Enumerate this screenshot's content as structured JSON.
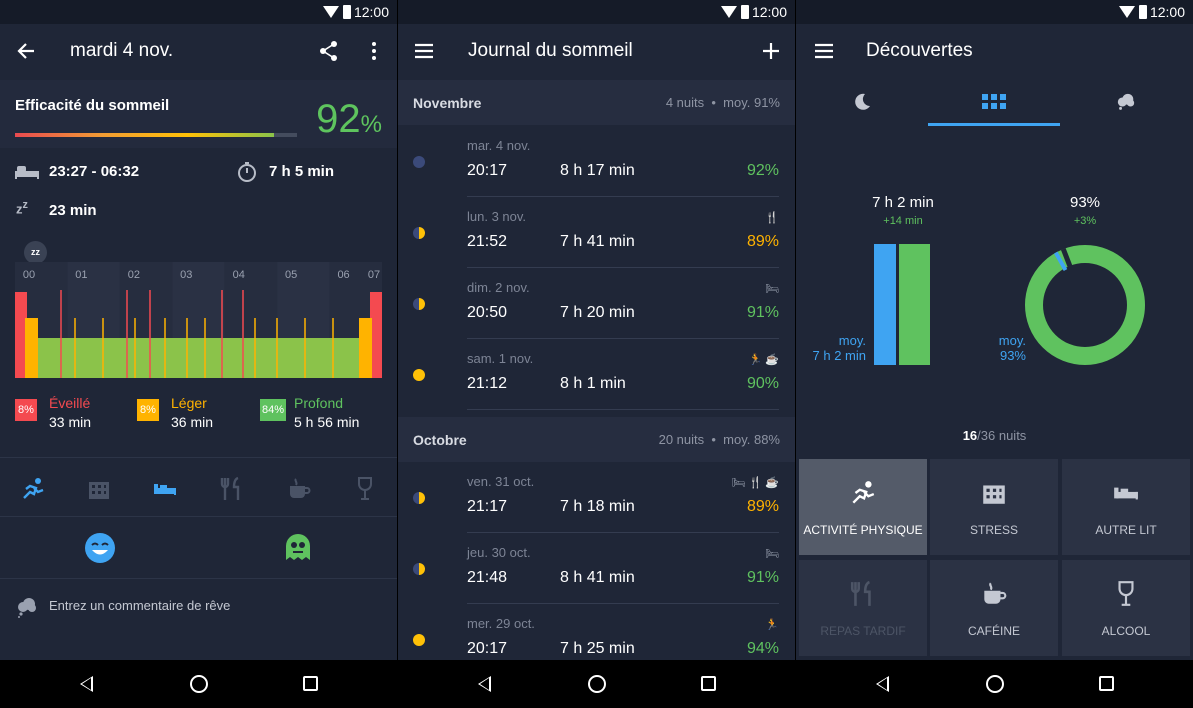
{
  "status_time": "12:00",
  "screen1": {
    "title": "mardi 4 nov.",
    "efficiency_label": "Efficacité du sommeil",
    "efficiency_value": "92",
    "efficiency_unit": "%",
    "efficiency_fraction": 0.92,
    "bed_time": "23:27 - 06:32",
    "duration": "7 h 5 min",
    "fall_asleep": "23 min",
    "hours": [
      "00",
      "01",
      "02",
      "03",
      "04",
      "05",
      "06",
      "07"
    ],
    "legend": [
      {
        "pct": "8%",
        "name": "Éveillé",
        "time": "33 min",
        "color": "#f44a50"
      },
      {
        "pct": "8%",
        "name": "Léger",
        "time": "36 min",
        "color": "#ffb300"
      },
      {
        "pct": "84%",
        "name": "Profond",
        "time": "5 h 56 min",
        "color": "#5fc25f"
      }
    ],
    "comment_placeholder": "Entrez un commentaire de rêve"
  },
  "screen2": {
    "title": "Journal du sommeil",
    "sections": [
      {
        "name": "Novembre",
        "meta": "4 nuits",
        "avg": "moy. 91%"
      },
      {
        "name": "Octobre",
        "meta": "20 nuits",
        "avg": "moy. 88%"
      }
    ],
    "entries": [
      {
        "day": "mar. 4 nov.",
        "bed": "20:17",
        "dur": "8 h 17 min",
        "q": "92%",
        "qcolor": "#5fc25f",
        "icons": "",
        "moon": "#3b4a7a"
      },
      {
        "day": "lun. 3 nov.",
        "bed": "21:52",
        "dur": "7 h 41 min",
        "q": "89%",
        "qcolor": "#ffb300",
        "icons": "🍴",
        "moon": "#ffc107"
      },
      {
        "day": "dim. 2 nov.",
        "bed": "20:50",
        "dur": "7 h 20 min",
        "q": "91%",
        "qcolor": "#5fc25f",
        "icons": "🛏",
        "moon": "#ffc107"
      },
      {
        "day": "sam. 1 nov.",
        "bed": "21:12",
        "dur": "8 h 1 min",
        "q": "90%",
        "qcolor": "#5fc25f",
        "icons": "🏃 ☕",
        "moon": "#ffc107"
      },
      {
        "day": "ven. 31 oct.",
        "bed": "21:17",
        "dur": "7 h 18 min",
        "q": "89%",
        "qcolor": "#ffb300",
        "icons": "🛏 🍴 ☕",
        "moon": "#ffc107"
      },
      {
        "day": "jeu. 30 oct.",
        "bed": "21:48",
        "dur": "8 h 41 min",
        "q": "91%",
        "qcolor": "#5fc25f",
        "icons": "🛏",
        "moon": "#ffc107"
      },
      {
        "day": "mer. 29 oct.",
        "bed": "20:17",
        "dur": "7 h 25 min",
        "q": "94%",
        "qcolor": "#5fc25f",
        "icons": "🏃",
        "moon": "#ffc107"
      }
    ]
  },
  "screen3": {
    "title": "Découvertes",
    "bar_value": "7 h 2 min",
    "bar_delta": "+14 min",
    "bar_avg_label": "moy.",
    "bar_avg_value": "7 h 2 min",
    "ring_value": "93%",
    "ring_delta": "+3%",
    "ring_avg_label": "moy.",
    "ring_avg_value": "93%",
    "ring_fraction": 0.93,
    "nights_count": "16",
    "nights_total": "/36 nuits",
    "categories": [
      {
        "label": "ACTIVITÉ PHYSIQUE",
        "state": "active"
      },
      {
        "label": "STRESS",
        "state": "normal"
      },
      {
        "label": "AUTRE LIT",
        "state": "normal"
      },
      {
        "label": "REPAS TARDIF",
        "state": "disabled"
      },
      {
        "label": "CAFÉINE",
        "state": "normal"
      },
      {
        "label": "ALCOOL",
        "state": "normal"
      }
    ]
  }
}
